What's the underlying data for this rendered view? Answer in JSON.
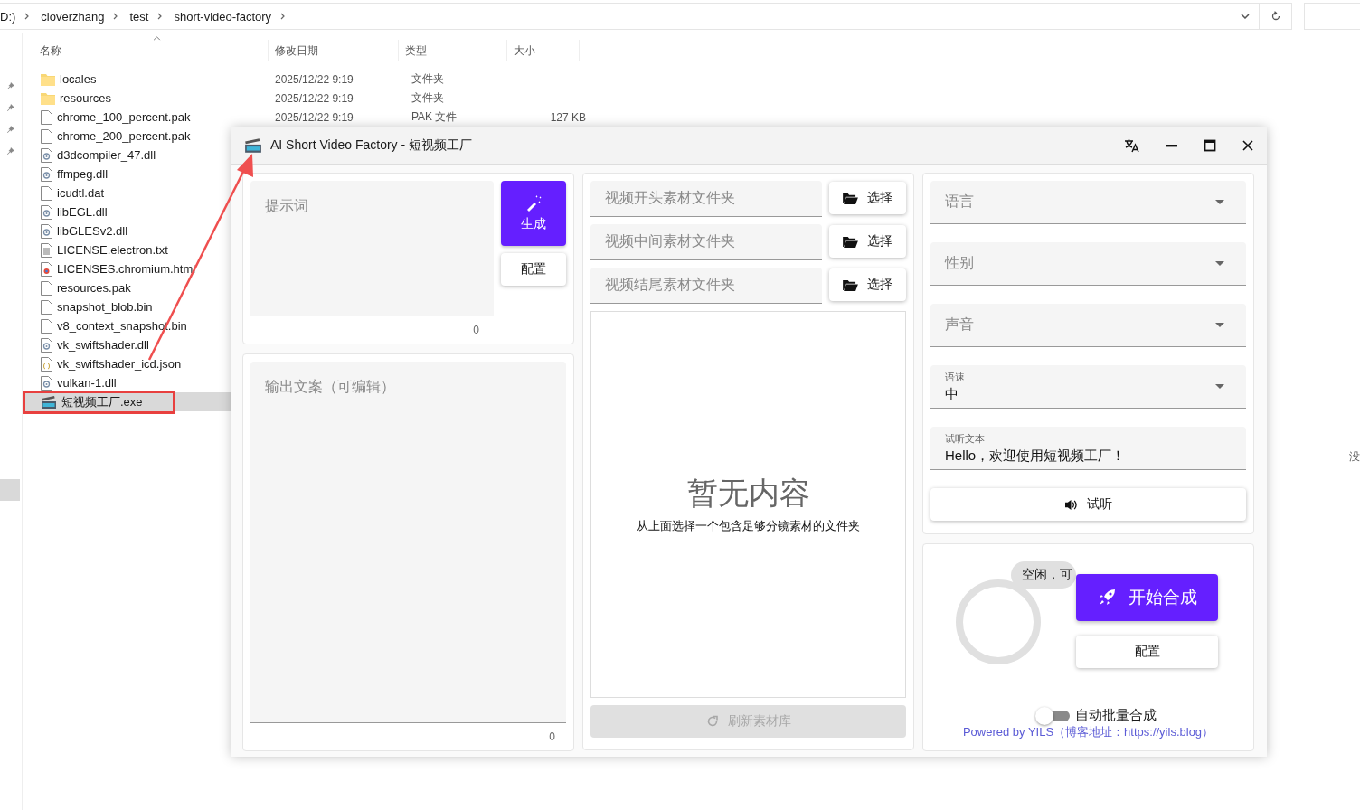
{
  "explorer": {
    "breadcrumb": [
      "D:)",
      "cloverzhang",
      "test",
      "short-video-factory"
    ],
    "columns": [
      {
        "label": "名称",
        "sorted": true
      },
      {
        "label": "修改日期",
        "sorted": false
      },
      {
        "label": "类型",
        "sorted": false
      },
      {
        "label": "大小",
        "sorted": false
      }
    ],
    "files": [
      {
        "name": "locales",
        "kind": "folder",
        "date": "2025/12/22 9:19",
        "type": "文件夹",
        "selected": false,
        "highlighted": false
      },
      {
        "name": "resources",
        "kind": "folder",
        "date": "2025/12/22 9:19",
        "type": "文件夹",
        "selected": false,
        "highlighted": false
      },
      {
        "name": "chrome_100_percent.pak",
        "kind": "file",
        "date": "2025/12/22 9:19",
        "type": "PAK 文件",
        "size": "127 KB",
        "selected": false,
        "highlighted": false
      },
      {
        "name": "chrome_200_percent.pak",
        "kind": "file",
        "selected": false,
        "highlighted": false
      },
      {
        "name": "d3dcompiler_47.dll",
        "kind": "dll",
        "selected": false,
        "highlighted": false
      },
      {
        "name": "ffmpeg.dll",
        "kind": "dll",
        "selected": false,
        "highlighted": false
      },
      {
        "name": "icudtl.dat",
        "kind": "file",
        "selected": false,
        "highlighted": false
      },
      {
        "name": "libEGL.dll",
        "kind": "dll",
        "selected": false,
        "highlighted": false
      },
      {
        "name": "libGLESv2.dll",
        "kind": "dll",
        "selected": false,
        "highlighted": false
      },
      {
        "name": "LICENSE.electron.txt",
        "kind": "text",
        "selected": false,
        "highlighted": false
      },
      {
        "name": "LICENSES.chromium.html",
        "kind": "html",
        "selected": false,
        "highlighted": false
      },
      {
        "name": "resources.pak",
        "kind": "file",
        "selected": false,
        "highlighted": false
      },
      {
        "name": "snapshot_blob.bin",
        "kind": "file",
        "selected": false,
        "highlighted": false
      },
      {
        "name": "v8_context_snapshot.bin",
        "kind": "file",
        "selected": false,
        "highlighted": false
      },
      {
        "name": "vk_swiftshader.dll",
        "kind": "dll",
        "selected": false,
        "highlighted": false
      },
      {
        "name": "vk_swiftshader_icd.json",
        "kind": "json",
        "selected": false,
        "highlighted": false
      },
      {
        "name": "vulkan-1.dll",
        "kind": "dll",
        "selected": false,
        "highlighted": false
      },
      {
        "name": "短视频工厂.exe",
        "kind": "exe",
        "selected": true,
        "highlighted": true
      }
    ],
    "side_text": "没",
    "annotation_arrow": true
  },
  "app": {
    "title": "AI Short Video Factory - 短视频工厂",
    "prompt": {
      "placeholder": "提示词",
      "count": "0"
    },
    "generate_button": "生成",
    "config_button": "配置",
    "output": {
      "placeholder": "输出文案（可编辑）",
      "count": "0"
    },
    "folders": [
      {
        "placeholder": "视频开头素材文件夹",
        "button": "选择"
      },
      {
        "placeholder": "视频中间素材文件夹",
        "button": "选择"
      },
      {
        "placeholder": "视频结尾素材文件夹",
        "button": "选择"
      }
    ],
    "empty": {
      "title": "暂无内容",
      "subtitle": "从上面选择一个包含足够分镜素材的文件夹"
    },
    "refresh_button": {
      "label": "刷新素材库",
      "disabled": true
    },
    "selects": [
      {
        "label": "语言"
      },
      {
        "label": "性别"
      },
      {
        "label": "声音"
      },
      {
        "label": "语速",
        "value": "中"
      }
    ],
    "preview_text": {
      "label": "试听文本",
      "value": "Hello，欢迎使用短视频工厂！"
    },
    "listen_button": "试听",
    "status": "空闲，可",
    "start_button": "开始合成",
    "synth_config_button": "配置",
    "auto_batch": {
      "label": "自动批量合成",
      "on": false
    },
    "footer": "Powered by YILS（博客地址：https://yils.blog）"
  }
}
